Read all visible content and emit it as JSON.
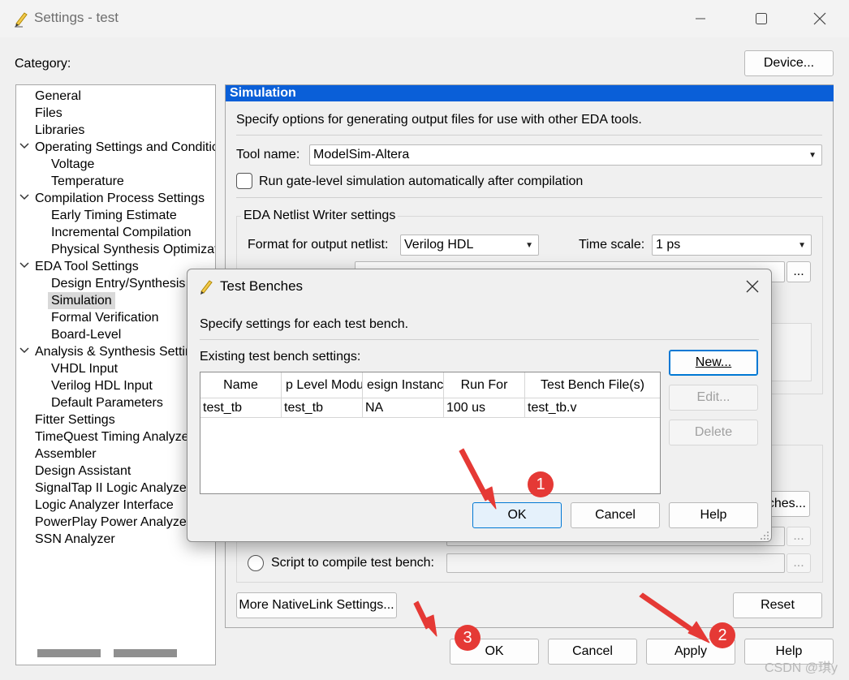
{
  "window": {
    "title": "Settings - test",
    "controls": [
      "minimize",
      "maximize",
      "close"
    ]
  },
  "category_label": "Category:",
  "device_button": "Device...",
  "tree": [
    {
      "label": "General",
      "level": 0
    },
    {
      "label": "Files",
      "level": 0
    },
    {
      "label": "Libraries",
      "level": 0
    },
    {
      "label": "Operating Settings and Conditic",
      "level": 0,
      "expanded": true
    },
    {
      "label": "Voltage",
      "level": 1
    },
    {
      "label": "Temperature",
      "level": 1
    },
    {
      "label": "Compilation Process Settings",
      "level": 0,
      "expanded": true
    },
    {
      "label": "Early Timing Estimate",
      "level": 1
    },
    {
      "label": "Incremental Compilation",
      "level": 1
    },
    {
      "label": "Physical Synthesis Optimizati",
      "level": 1
    },
    {
      "label": "EDA Tool Settings",
      "level": 0,
      "expanded": true
    },
    {
      "label": "Design Entry/Synthesis",
      "level": 1
    },
    {
      "label": "Simulation",
      "level": 1,
      "selected": true
    },
    {
      "label": "Formal Verification",
      "level": 1
    },
    {
      "label": "Board-Level",
      "level": 1
    },
    {
      "label": "Analysis & Synthesis Settin",
      "level": 0,
      "expanded": true
    },
    {
      "label": "VHDL Input",
      "level": 1
    },
    {
      "label": "Verilog HDL Input",
      "level": 1
    },
    {
      "label": "Default Parameters",
      "level": 1
    },
    {
      "label": "Fitter Settings",
      "level": 0
    },
    {
      "label": "TimeQuest Timing Analyze",
      "level": 0
    },
    {
      "label": "Assembler",
      "level": 0
    },
    {
      "label": "Design Assistant",
      "level": 0
    },
    {
      "label": "SignalTap II Logic Analyze",
      "level": 0
    },
    {
      "label": "Logic Analyzer Interface",
      "level": 0
    },
    {
      "label": "PowerPlay Power Analyzer",
      "level": 0
    },
    {
      "label": "SSN Analyzer",
      "level": 0
    }
  ],
  "panel": {
    "heading": "Simulation",
    "description": "Specify options for generating output files for use with other EDA tools.",
    "tool_name_label": "Tool name:",
    "tool_name_value": "ModelSim-Altera",
    "run_gate_level_label": "Run gate-level simulation automatically after compilation",
    "netlist_group_title": "EDA Netlist Writer settings",
    "format_label": "Format for output netlist:",
    "format_value": "Verilog HDL",
    "timescale_label": "Time scale:",
    "timescale_value": "1 ps",
    "partial_button": "ches...",
    "ellipsis": "...",
    "script_label": "Script to compile test bench:",
    "more_nativelink_button": "More NativeLink Settings...",
    "reset_button": "Reset"
  },
  "bottom_buttons": {
    "ok": "OK",
    "cancel": "Cancel",
    "apply": "Apply",
    "help": "Help"
  },
  "dialog": {
    "title": "Test Benches",
    "description": "Specify settings for each test bench.",
    "existing_label": "Existing test bench settings:",
    "columns": [
      "Name",
      "p Level Modu",
      "esign Instanc",
      "Run For",
      "Test Bench File(s)"
    ],
    "rows": [
      [
        "test_tb",
        "test_tb",
        "NA",
        "100 us",
        "test_tb.v"
      ]
    ],
    "new_button": "New...",
    "edit_button": "Edit...",
    "delete_button": "Delete",
    "ok_button": "OK",
    "cancel_button": "Cancel",
    "help_button": "Help"
  },
  "annotations": {
    "badge1": "1",
    "badge2": "2",
    "badge3": "3",
    "arrow_color": "#e53935"
  },
  "watermark": "CSDN @琪y",
  "colors": {
    "accent": "#0a5fd8",
    "annotation": "#e53935"
  }
}
